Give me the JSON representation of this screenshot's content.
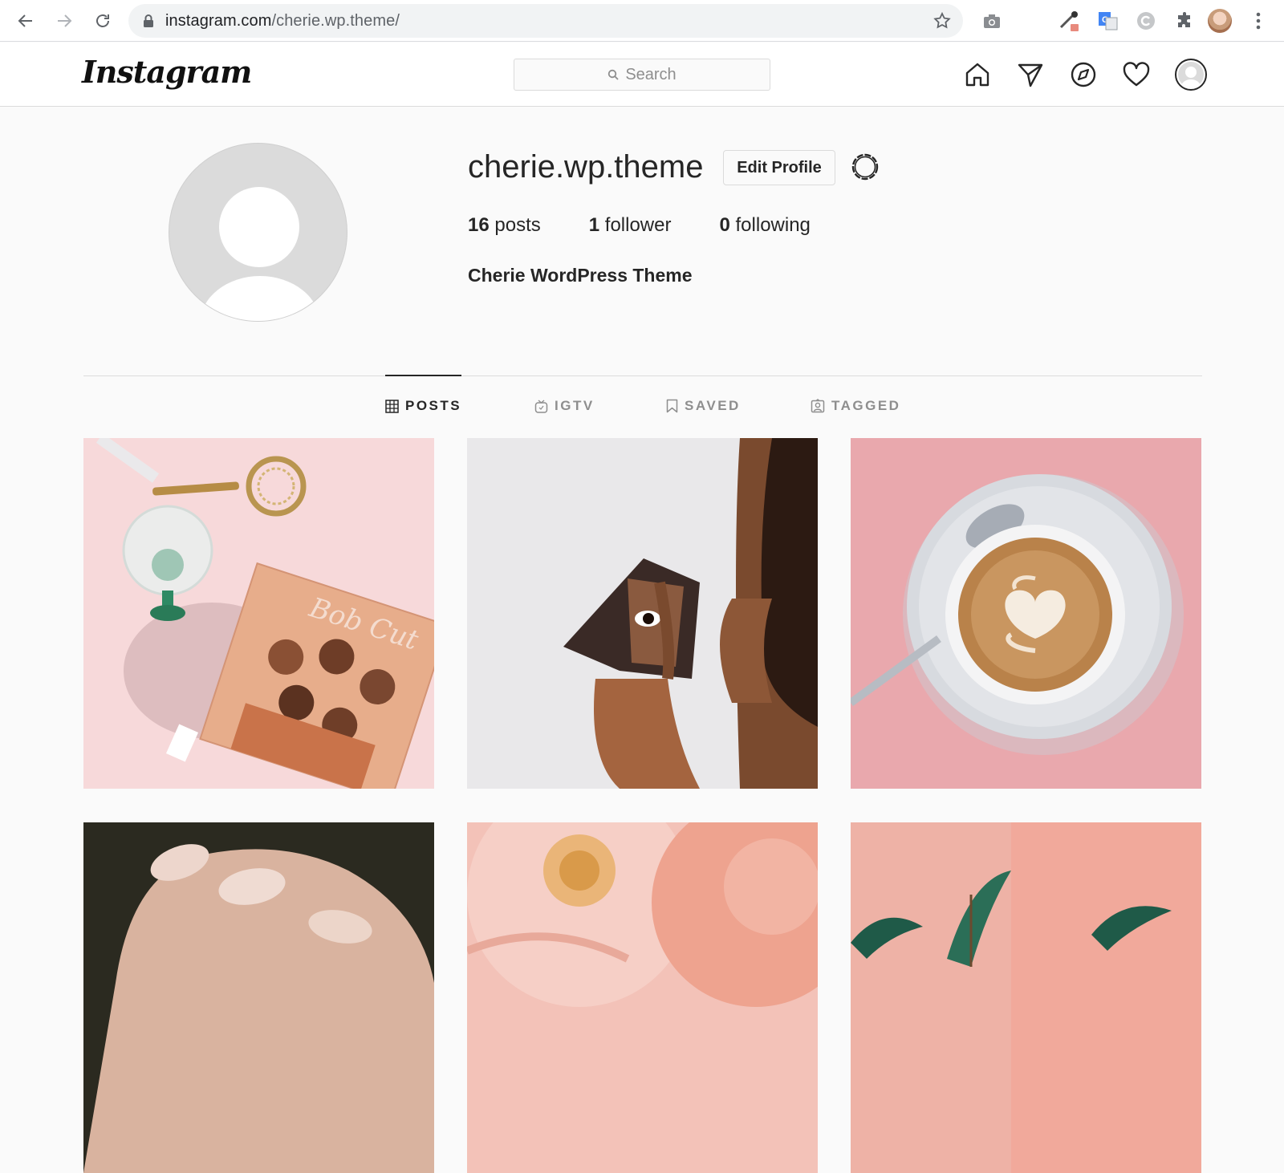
{
  "browser": {
    "url_host": "instagram.com",
    "url_path": "/cherie.wp.theme/"
  },
  "header": {
    "logo": "Instagram",
    "search_placeholder": "Search"
  },
  "profile": {
    "username": "cherie.wp.theme",
    "edit_button": "Edit Profile",
    "stats": [
      {
        "count": "16",
        "label": "posts"
      },
      {
        "count": "1",
        "label": "follower"
      },
      {
        "count": "0",
        "label": "following"
      }
    ],
    "full_name": "Cherie WordPress Theme"
  },
  "tabs": [
    {
      "label": "POSTS",
      "active": true
    },
    {
      "label": "IGTV",
      "active": false
    },
    {
      "label": "SAVED",
      "active": false
    },
    {
      "label": "TAGGED",
      "active": false
    }
  ],
  "colors": {
    "accent_text": "#262626",
    "muted": "#8e8e8e",
    "border": "#dbdbdb"
  }
}
